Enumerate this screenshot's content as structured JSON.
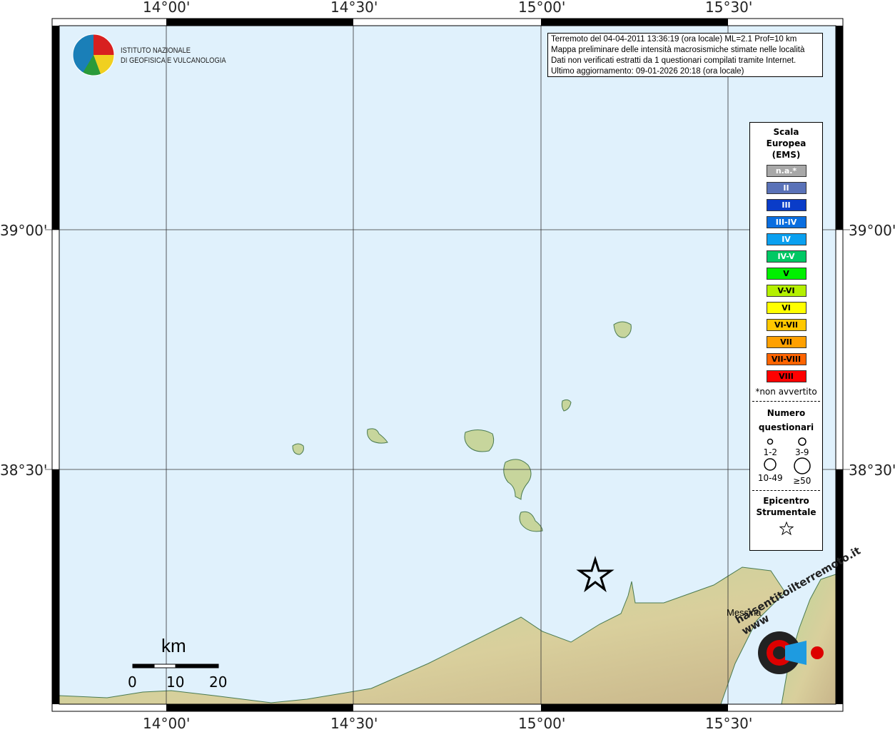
{
  "axes": {
    "lon_labels": [
      "14°00'",
      "14°30'",
      "15°00'",
      "15°30'"
    ],
    "lat_labels": [
      "39°00'",
      "38°30'"
    ]
  },
  "info": {
    "lines": [
      "Terremoto del 04-04-2011 13:36:19 (ora locale) ML=2.1 Prof=10 km",
      "Mappa preliminare delle intensità macrosismiche stimate nelle località",
      "Dati non verificati estratti da 1 questionari compilati tramite Internet.",
      "Ultimo aggiornamento: 09-01-2026 20:18 (ora locale)"
    ]
  },
  "logo": {
    "line1": "ISTITUTO NAZIONALE",
    "line2": "DI GEOFISICA E VULCANOLOGIA"
  },
  "legend": {
    "title": [
      "Scala",
      "Europea",
      "(EMS)"
    ],
    "scale": [
      {
        "label": "n.a.*",
        "color": "#a8a8a8"
      },
      {
        "label": "II",
        "color": "#5a72b8"
      },
      {
        "label": "III",
        "color": "#0a3cc8"
      },
      {
        "label": "III-IV",
        "color": "#0a6ee0"
      },
      {
        "label": "IV",
        "color": "#0aa0f0"
      },
      {
        "label": "IV-V",
        "color": "#00c864"
      },
      {
        "label": "V",
        "color": "#00f000"
      },
      {
        "label": "V-VI",
        "color": "#b4f000"
      },
      {
        "label": "VI",
        "color": "#ffff00"
      },
      {
        "label": "VI-VII",
        "color": "#ffc800"
      },
      {
        "label": "VII",
        "color": "#ffa000"
      },
      {
        "label": "VII-VIII",
        "color": "#ff6400"
      },
      {
        "label": "VIII",
        "color": "#ff0000"
      }
    ],
    "note": "*non avvertito",
    "q_title": [
      "Numero",
      "questionari"
    ],
    "q_sizes": [
      "1-2",
      "3-9",
      "10-49",
      "≥50"
    ],
    "epi_title": [
      "Epicentro",
      "Strumentale"
    ]
  },
  "place": "Messina",
  "scalebar": {
    "unit": "km",
    "ticks": [
      "0",
      "10",
      "20"
    ]
  },
  "watermark": "haisentitoilterremoto.it www"
}
